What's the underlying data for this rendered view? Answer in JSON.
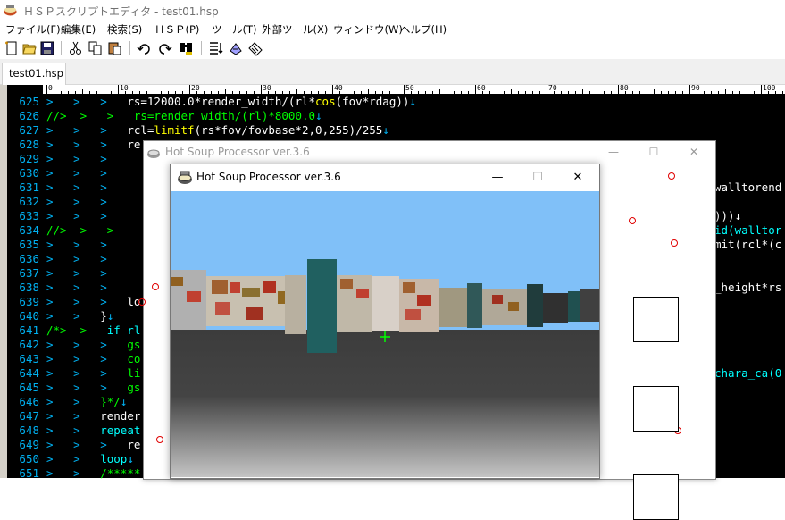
{
  "app": {
    "title": "ＨＳＰスクリプトエディタ - test01.hsp"
  },
  "menu": [
    {
      "label": "ファイル(F)"
    },
    {
      "label": "編集(E)"
    },
    {
      "label": "検索(S)"
    },
    {
      "label": "ＨＳＰ(P)"
    },
    {
      "label": "ツール(T)"
    },
    {
      "label": "外部ツール(X)"
    },
    {
      "label": "ウィンドウ(W)"
    },
    {
      "label": "ヘルプ(H)"
    }
  ],
  "toolbar": {
    "icons": [
      "new-file-icon",
      "open-file-icon",
      "save-icon",
      "cut-icon",
      "copy-icon",
      "paste-icon",
      "undo-icon",
      "redo-icon",
      "search-replace-icon",
      "run-list-icon",
      "compile-icon",
      "debug-icon"
    ]
  },
  "tabs": [
    {
      "label": "test01.hsp"
    }
  ],
  "ruler": {
    "labels": [
      "0",
      "10",
      "20",
      "30",
      "40",
      "50",
      "60",
      "70",
      "80",
      "90",
      "100"
    ]
  },
  "code_lines": [
    {
      "num": "625",
      "prefix": ">   >   >   ",
      "segments": [
        {
          "t": "rs=12000.0*render_width/(rl*",
          "c": "txt"
        },
        {
          "t": "cos",
          "c": "fn"
        },
        {
          "t": "(fov*rdag))",
          "c": "txt"
        },
        {
          "t": "↓",
          "c": "ret"
        }
      ]
    },
    {
      "num": "626",
      "prefix": "//>  >   >   ",
      "segments": [
        {
          "t": "rs=render_width/(rl)*8000.0",
          "c": "cmt"
        },
        {
          "t": "↓",
          "c": "ret"
        }
      ],
      "comment_prefix": true
    },
    {
      "num": "627",
      "prefix": ">   >   >   ",
      "segments": [
        {
          "t": "rcl=",
          "c": "txt"
        },
        {
          "t": "limitf",
          "c": "fn"
        },
        {
          "t": "(rs*fov/fovbase*2,0,255)/255",
          "c": "txt"
        },
        {
          "t": "↓",
          "c": "ret"
        }
      ]
    },
    {
      "num": "628",
      "prefix": ">   >   >   ",
      "segments": [
        {
          "t": "re",
          "c": "txt"
        }
      ]
    },
    {
      "num": "629",
      "prefix": ">   >   >   ",
      "segments": []
    },
    {
      "num": "630",
      "prefix": ">   >   >   ",
      "segments": []
    },
    {
      "num": "631",
      "prefix": ">   >   >   ",
      "segments": []
    },
    {
      "num": "632",
      "prefix": ">   >   >   ",
      "segments": []
    },
    {
      "num": "633",
      "prefix": ">   >   >   ",
      "segments": []
    },
    {
      "num": "634",
      "prefix": "//>  >   >   ",
      "segments": [],
      "comment_prefix": true
    },
    {
      "num": "635",
      "prefix": ">   >   >   ",
      "segments": []
    },
    {
      "num": "636",
      "prefix": ">   >   >   ",
      "segments": []
    },
    {
      "num": "637",
      "prefix": ">   >   >   ",
      "segments": []
    },
    {
      "num": "638",
      "prefix": ">   >   >   ",
      "segments": []
    },
    {
      "num": "639",
      "prefix": ">   >   >   ",
      "segments": [
        {
          "t": "lo",
          "c": "txt"
        }
      ]
    },
    {
      "num": "640",
      "prefix": ">   >   ",
      "segments": [
        {
          "t": "}",
          "c": "txt"
        },
        {
          "t": "↓",
          "c": "ret"
        }
      ]
    },
    {
      "num": "641",
      "prefix": "/*>  >   ",
      "segments": [
        {
          "t": "if rl!",
          "c": "kw"
        }
      ],
      "comment_prefix": true
    },
    {
      "num": "642",
      "prefix": ">   >   >   ",
      "segments": [
        {
          "t": "gs",
          "c": "cmt"
        }
      ]
    },
    {
      "num": "643",
      "prefix": ">   >   >   ",
      "segments": [
        {
          "t": "co",
          "c": "cmt"
        }
      ]
    },
    {
      "num": "644",
      "prefix": ">   >   >   ",
      "segments": [
        {
          "t": "li",
          "c": "cmt"
        }
      ]
    },
    {
      "num": "645",
      "prefix": ">   >   >   ",
      "segments": [
        {
          "t": "gs",
          "c": "cmt"
        }
      ]
    },
    {
      "num": "646",
      "prefix": ">   >   ",
      "segments": [
        {
          "t": "}*/",
          "c": "cmt"
        },
        {
          "t": "↓",
          "c": "ret"
        }
      ]
    },
    {
      "num": "647",
      "prefix": ">   >   ",
      "segments": [
        {
          "t": "render",
          "c": "txt"
        }
      ]
    },
    {
      "num": "648",
      "prefix": ">   >   ",
      "segments": [
        {
          "t": "repeat",
          "c": "kw"
        }
      ]
    },
    {
      "num": "649",
      "prefix": ">   >   >   ",
      "segments": [
        {
          "t": "re",
          "c": "txt"
        }
      ]
    },
    {
      "num": "650",
      "prefix": ">   >   ",
      "segments": [
        {
          "t": "loop",
          "c": "kw"
        },
        {
          "t": "↓",
          "c": "ret"
        }
      ]
    },
    {
      "num": "651",
      "prefix": ">   >   ",
      "segments": [
        {
          "t": "/*****",
          "c": "cmt"
        }
      ]
    }
  ],
  "right_code": [
    {
      "text": "walltorend",
      "c": "txt",
      "line": 631
    },
    {
      "text": ")))↓",
      "c": "txt",
      "line": 633
    },
    {
      "text": "id(walltor",
      "c": "kw",
      "line": 634
    },
    {
      "text": "mit(rcl*(c",
      "c": "txt",
      "line": 635
    },
    {
      "text": "_height*rs",
      "c": "txt",
      "line": 638
    },
    {
      "text": "chara_ca(0",
      "c": "kw",
      "line": 644
    }
  ],
  "back_window": {
    "title": "Hot Soup Processor ver.3.6",
    "min": "—",
    "max": "☐",
    "close": "✕"
  },
  "front_window": {
    "title": "Hot Soup Processor ver.3.6",
    "min": "—",
    "max": "☐",
    "close": "✕"
  },
  "colors": {
    "sky": "#80c0f8",
    "floor_top": "#3c3c3c",
    "floor_bottom": "#c0c0c0",
    "pillar": "#206060",
    "editor_bg": "#000000",
    "line_number": "#00b0f0",
    "comment": "#00ff00"
  }
}
